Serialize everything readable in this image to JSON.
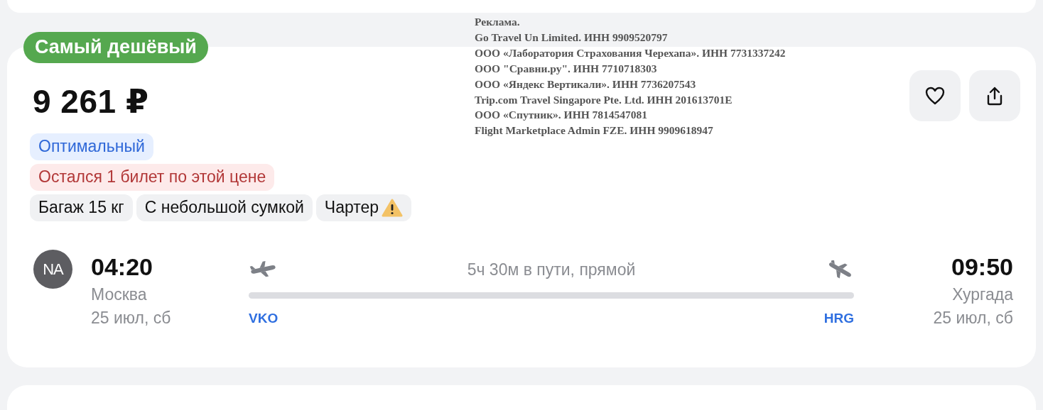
{
  "badge": "Самый дешёвый",
  "price": "9 261 ₽",
  "tags": [
    {
      "kind": "info",
      "label": "Оптимальный"
    },
    {
      "kind": "warning",
      "label": "Остался 1 билет по этой цене"
    }
  ],
  "features": [
    {
      "label": "Багаж 15 кг",
      "alert": false
    },
    {
      "label": "С небольшой сумкой",
      "alert": false
    },
    {
      "label": "Чартер",
      "alert": true
    }
  ],
  "ad_lines": [
    "Реклама.",
    "Go Travel Un Limited. ИНН 9909520797",
    "ООО «Лаборатория Страхования Черехапа». ИНН 7731337242",
    "ООО \"Сравни.ру\". ИНН 7710718303",
    "ООО «Яндекс Вертикали». ИНН 7736207543",
    "Trip.com Travel Singapore Pte. Ltd. ИНН 201613701E",
    "ООО «Спутник». ИНН 7814547081",
    "Flight Marketplace Admin FZE. ИНН 9909618947"
  ],
  "airline_logo": "NA",
  "departure": {
    "time": "04:20",
    "city": "Москва",
    "date": "25 июл, сб",
    "airport": "VKO"
  },
  "arrival": {
    "time": "09:50",
    "city": "Хургада",
    "date": "25 июл, сб",
    "airport": "HRG"
  },
  "duration": "5ч 30м в пути, прямой"
}
